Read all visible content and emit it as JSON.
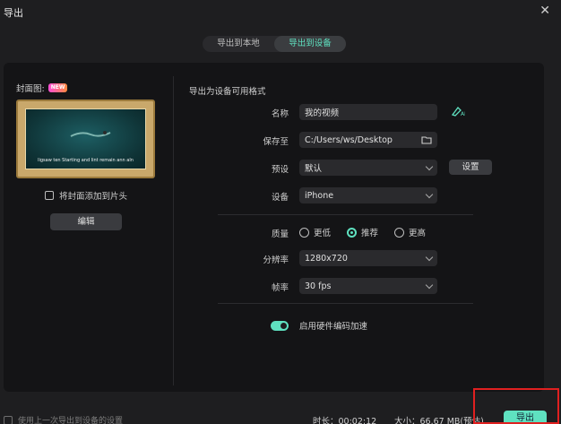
{
  "window": {
    "title": "导出"
  },
  "tabs": [
    {
      "label": "导出到本地",
      "active": false
    },
    {
      "label": "导出到设备",
      "active": true
    }
  ],
  "left": {
    "cover_label": "封面图:",
    "badge": "NEW",
    "thumbnail_caption": "ligsaw ten Starting and lint remain ann aln",
    "checkbox_label": "将封面添加到片头",
    "edit_label": "编辑"
  },
  "form": {
    "section_title": "导出为设备可用格式",
    "name_label": "名称",
    "name_value": "我的视频",
    "save_label": "保存至",
    "save_value": "C:/Users/ws/Desktop",
    "preset_label": "预设",
    "preset_value": "默认",
    "settings_label": "设置",
    "device_label": "设备",
    "device_value": "iPhone",
    "quality_label": "质量",
    "quality_options": [
      "更低",
      "推荐",
      "更高"
    ],
    "quality_selected": "推荐",
    "resolution_label": "分辨率",
    "resolution_value": "1280x720",
    "framerate_label": "帧率",
    "framerate_value": "30 fps",
    "hw_accel_label": "启用硬件编码加速"
  },
  "footer": {
    "use_last_label": "使用上一次导出到设备的设置",
    "duration": "时长：00:02:12",
    "size": "大小：66.67 MB(预估)",
    "export_label": "导出"
  },
  "colors": {
    "accent": "#5fe1c0",
    "highlight": "#e02020"
  }
}
